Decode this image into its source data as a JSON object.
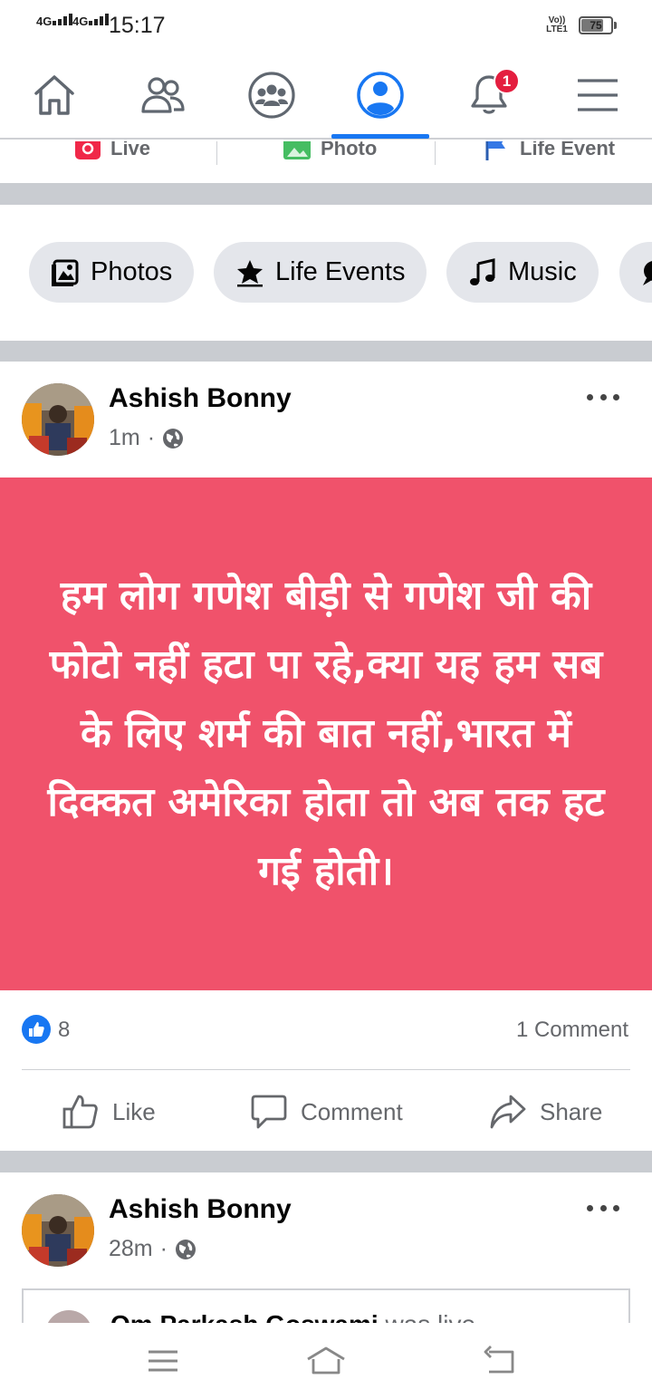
{
  "status_bar": {
    "signal1": "4G",
    "signal2": "4G",
    "time": "15:17",
    "volte": "Vo)) LTE1",
    "battery": "75",
    "battery_level": 0.75
  },
  "nav": {
    "items": [
      "home-icon",
      "friends-icon",
      "groups-icon",
      "profile-icon",
      "notifications-icon",
      "menu-icon"
    ],
    "active": "profile-icon",
    "notification_badge": "1"
  },
  "composer": {
    "live_label": "Live",
    "photo_label": "Photo",
    "life_event_label": "Life Event"
  },
  "chips": [
    {
      "label": "Photos",
      "icon": "photos-icon"
    },
    {
      "label": "Life Events",
      "icon": "star-icon"
    },
    {
      "label": "Music",
      "icon": "music-note-icon"
    }
  ],
  "post1": {
    "author": "Ashish Bonny",
    "time": "1m",
    "privacy": "globe-icon",
    "text": "हम लोग गणेश बीड़ी से गणेश जी की फोटो नहीं हटा पा रहे,क्या यह हम सब के लिए शर्म की बात नहीं,भारत में दिक्कत अमेरिका होता तो अब तक हट गई होती।",
    "background_color": "#f0526b",
    "likes": "8",
    "comments": "1 Comment",
    "actions": {
      "like": "Like",
      "comment": "Comment",
      "share": "Share"
    }
  },
  "post2": {
    "author": "Ashish Bonny",
    "time": "28m",
    "privacy": "globe-icon",
    "shared_author": "Om Parkash Goswami",
    "shared_status": "was live."
  },
  "colors": {
    "accent": "#1877f2",
    "badge": "#e41e3f",
    "separator": "#c9ccd1"
  }
}
